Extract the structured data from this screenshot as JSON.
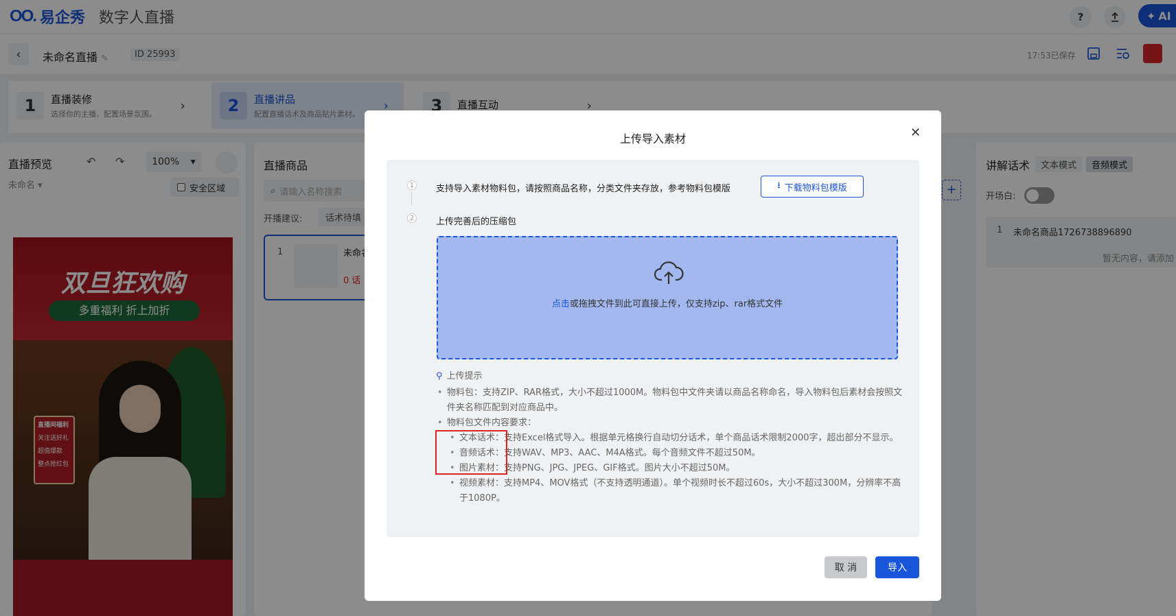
{
  "app": {
    "logo_mark": "OO.",
    "brand": "易企秀",
    "product": "数字人直播"
  },
  "topbar": {
    "help_label": "?",
    "ai_label": "AI"
  },
  "subbar": {
    "title": "未命名直播",
    "id_label": "ID",
    "id_value": "25993",
    "saved_text": "17:53已保存"
  },
  "steps": [
    {
      "num": "1",
      "title": "直播装修",
      "desc": "选择你的主播，配置场景氛围。"
    },
    {
      "num": "2",
      "title": "直播讲品",
      "desc": "配置直播话术及商品贴片素材。"
    },
    {
      "num": "3",
      "title": "直播互动",
      "desc": ""
    }
  ],
  "preview_panel": {
    "title": "直播预览",
    "name": "未命名",
    "zoom": "100%",
    "safe_area": "安全区域"
  },
  "poster": {
    "headline": "双旦狂欢购",
    "subline": "多重福利 折上加折",
    "side_title": "直播间福利",
    "side_items": [
      "关注送好礼",
      "超值爆款",
      "整点抢红包"
    ]
  },
  "products_panel": {
    "title": "直播商品",
    "search_placeholder": "请输入名称搜索",
    "advice_label": "开播建议:",
    "advice_tag": "话术待填",
    "item_index": "1",
    "item_name": "未命名",
    "item_count": "0 话"
  },
  "script_panel": {
    "title": "讲解话术",
    "mode_text": "文本模式",
    "mode_audio": "音频模式",
    "opening_label": "开场白:",
    "item_index": "1",
    "item_name": "未命名商品1726738896890",
    "empty_text": "暂无内容，请添加"
  },
  "modal": {
    "title": "上传导入素材",
    "step1_num": "1",
    "step1_text": "支持导入素材物料包，请按照商品名称，分类文件夹存放，参考物料包模版",
    "download_label": "下载物料包模版",
    "step2_num": "2",
    "step2_text": "上传完善后的压缩包",
    "upload_link": "点击",
    "upload_text": "或拖拽文件到此可直接上传，仅支持zip、rar格式文件",
    "tips_title": "上传提示",
    "tips": {
      "pkg": "物料包：支持ZIP、RAR格式，大小不超过1000M。物料包中文件夹请以商品名称命名，导入物料包后素材会按照文件夹名称匹配到对应商品中。",
      "content": "物料包文件内容要求：",
      "text_script": "文本话术：支持Excel格式导入。根据单元格换行自动切分话术，单个商品话术限制2000字，超出部分不显示。",
      "audio_script": "音频话术：支持WAV、MP3、AAC、M4A格式。每个音频文件不超过50M。",
      "image": "图片素材：支持PNG、JPG、JPEG、GIF格式。图片大小不超过50M。",
      "video": "视频素材：支持MP4、MOV格式（不支持透明通道）。单个视频时长不超过60s，大小不超过300M，分辨率不高于1080P。"
    },
    "cancel_label": "取 消",
    "import_label": "导入"
  }
}
